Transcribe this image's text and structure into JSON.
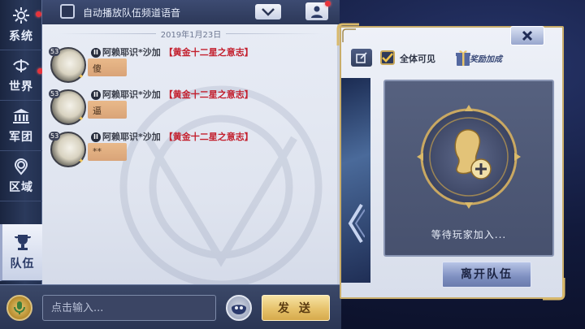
{
  "nav": {
    "items": [
      {
        "label": "系统",
        "icon": "settings-icon",
        "badge": true
      },
      {
        "label": "世界",
        "icon": "globe-icon",
        "badge": true
      },
      {
        "label": "军团",
        "icon": "temple-icon",
        "badge": false
      },
      {
        "label": "区域",
        "icon": "location-icon",
        "badge": false
      },
      {
        "label": "队伍",
        "icon": "trophy-icon",
        "badge": false,
        "active": true
      }
    ]
  },
  "chat": {
    "auto_play_label": "自动播放队伍频道语音",
    "date": "2019年1月23日",
    "messages": [
      {
        "level": "53",
        "rank_badge": "II",
        "name": "阿赖耶识*沙加",
        "title": "【黄金十二星之意志】",
        "text": "傻"
      },
      {
        "level": "53",
        "rank_badge": "II",
        "name": "阿赖耶识*沙加",
        "title": "【黄金十二星之意志】",
        "text": "逼"
      },
      {
        "level": "53",
        "rank_badge": "II",
        "name": "阿赖耶识*沙加",
        "title": "【黄金十二星之意志】",
        "text": "**"
      }
    ]
  },
  "input": {
    "placeholder": "点击输入...",
    "send_label": "发 送"
  },
  "team": {
    "visible_label": "全体可见",
    "bonus_label": "奖励加成",
    "waiting_text": "等待玩家加入...",
    "leave_label": "离开队伍"
  },
  "colors": {
    "gold": "#c9ad6a",
    "title_red": "#c3202e",
    "badge_red": "#e8333b",
    "send_gold": "#e6c26b",
    "chat_bg": "#e9edf6",
    "slot_bg": "#4f5a78"
  }
}
